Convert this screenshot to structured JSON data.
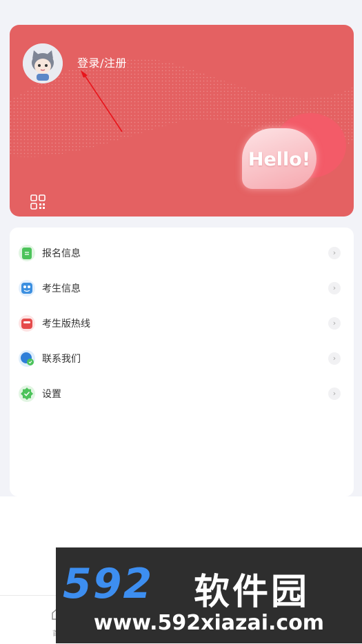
{
  "profile": {
    "login_label": "登录/注册",
    "bubble_text": "Hello!"
  },
  "menu": {
    "items": [
      {
        "label": "报名信息",
        "icon": "registration-info-icon",
        "color": "#4cc35a"
      },
      {
        "label": "考生信息",
        "icon": "candidate-info-icon",
        "color": "#3b8fe0"
      },
      {
        "label": "考生版热线",
        "icon": "hotline-icon",
        "color": "#e54b4b"
      },
      {
        "label": "联系我们",
        "icon": "contact-us-icon",
        "color": "#2f7fd8"
      },
      {
        "label": "设置",
        "icon": "settings-icon",
        "color": "#4cc35a"
      }
    ],
    "chevron": "›"
  },
  "tabbar": {
    "home_label": "首"
  },
  "watermark": {
    "brand": "592",
    "name": "软件园",
    "url": "www.592xiazai.com"
  },
  "colors": {
    "card_red": "#e46162",
    "page_bg": "#f2f3f8",
    "accent_red": "#f35b68"
  }
}
